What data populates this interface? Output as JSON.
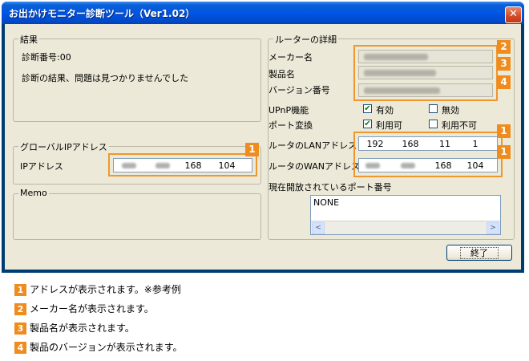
{
  "window": {
    "title": "お出かけモニター診断ツール（Ver1.02）",
    "close_glyph": "✕"
  },
  "result": {
    "title": "結果",
    "diag_number": "診断番号:00",
    "message": "診断の結果、問題は見つかりませんでした"
  },
  "global_ip": {
    "title": "グローバルIPアドレス",
    "label": "IPアドレス",
    "seg3": "168",
    "seg4": "104"
  },
  "memo": {
    "title": "Memo"
  },
  "router": {
    "title": "ルーターの詳細",
    "maker_label": "メーカー名",
    "product_label": "製品名",
    "version_label": "バージョン番号",
    "upnp_label": "UPnP機能",
    "upnp_enabled": "有効",
    "upnp_disabled": "無効",
    "port_label": "ポート変換",
    "port_available": "利用可",
    "port_unavailable": "利用不可",
    "lan_label": "ルータのLANアドレス",
    "lan": [
      "192",
      "168",
      "11",
      "1"
    ],
    "wan_label": "ルータのWANアドレス",
    "wan_seg3": "168",
    "wan_seg4": "104",
    "open_ports_label": "現在開放されているポート番号",
    "open_ports_value": "NONE"
  },
  "buttons": {
    "ok": "終了"
  },
  "badges": {
    "b1": "1",
    "b2": "2",
    "b3": "3",
    "b4": "4"
  },
  "legend": [
    {
      "num": "1",
      "text": "アドレスが表示されます。※参考例"
    },
    {
      "num": "2",
      "text": "メーカー名が表示されます。"
    },
    {
      "num": "3",
      "text": "製品名が表示されます。"
    },
    {
      "num": "4",
      "text": "製品のバージョンが表示されます。"
    }
  ],
  "colors": {
    "accent": "#f08c1e",
    "titlebar": "#0054e3",
    "dialog_bg": "#ece9d8"
  }
}
